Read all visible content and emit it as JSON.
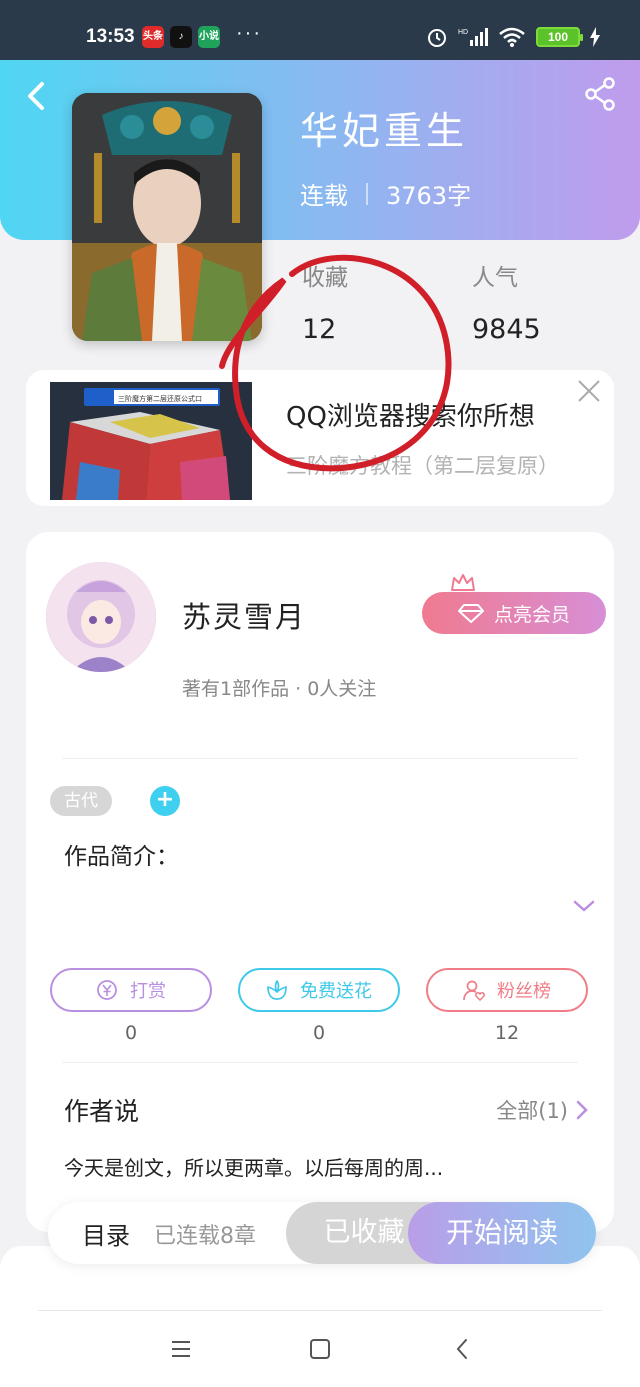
{
  "status_bar": {
    "time": "13:53",
    "app_icons": [
      "头条",
      "douyin-icon",
      "小说"
    ],
    "more": "···",
    "battery": "100"
  },
  "book": {
    "title": "华妃重生",
    "status": "连载",
    "word_count": "3763字",
    "stats": {
      "collect_label": "收藏",
      "collect_value": "12",
      "popularity_label": "人气",
      "popularity_value": "9845"
    }
  },
  "ad": {
    "title": "QQ浏览器搜索你所想",
    "subtitle": "三阶魔方教程（第二层复原）",
    "thumb_search_text": "三阶魔方第二层还原公式口"
  },
  "author": {
    "name": "苏灵雪月",
    "info": "著有1部作品 · 0人关注",
    "vip_label": "点亮会员"
  },
  "tags": [
    "古代"
  ],
  "intro_label": "作品简介：",
  "actions": [
    {
      "label": "打赏",
      "count": "0",
      "color": "#b98fe0"
    },
    {
      "label": "免费送花",
      "count": "0",
      "color": "#3fc9e8"
    },
    {
      "label": "粉丝榜",
      "count": "12",
      "color": "#f07d86"
    }
  ],
  "author_says": {
    "title": "作者说",
    "see_all": "全部(1)",
    "text": "今天是创文，所以更两章。以后每周的周..."
  },
  "bottom_bar": {
    "toc": "目录",
    "chapters": "已连载8章",
    "collected": "已收藏",
    "read": "开始阅读"
  },
  "colors": {
    "header_gradient_start": "#4fd6f2",
    "header_gradient_end": "#c09ced",
    "annotation": "#d11f2a"
  }
}
